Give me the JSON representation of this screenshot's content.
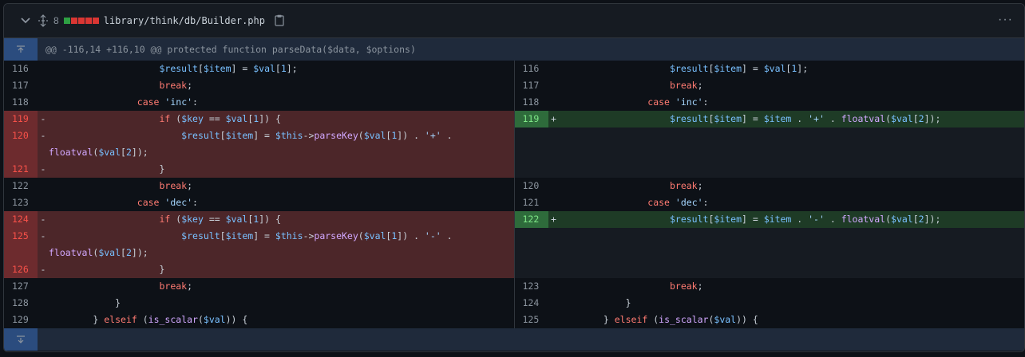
{
  "header": {
    "change_count": "8",
    "file_path": "library/think/db/Builder.php",
    "diffstat_colors": [
      "#2ea043",
      "#da3633",
      "#da3633",
      "#da3633",
      "#da3633"
    ],
    "more_label": "···"
  },
  "hunk": {
    "text": "@@ -116,14 +116,10 @@ protected function parseData($data, $options)"
  },
  "left": {
    "lines": [
      "116",
      "117",
      "118",
      "119",
      "120",
      "",
      "121",
      "122",
      "123",
      "124",
      "125",
      "",
      "126",
      "127",
      "128",
      "129"
    ],
    "markers": [
      "",
      "",
      "",
      "-",
      "-",
      "",
      "-",
      "",
      "",
      "-",
      "-",
      "",
      "-",
      "",
      "",
      ""
    ]
  },
  "right": {
    "lines": [
      "116",
      "117",
      "118",
      "119",
      "",
      "",
      "",
      "120",
      "121",
      "122",
      "",
      "",
      "",
      "123",
      "124",
      "125"
    ],
    "markers": [
      "",
      "",
      "",
      "+",
      "",
      "",
      "",
      "",
      "",
      "+",
      "",
      "",
      "",
      "",
      "",
      ""
    ]
  }
}
